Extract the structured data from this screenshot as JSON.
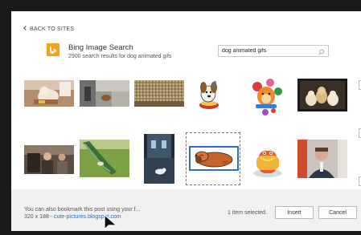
{
  "dialog": {
    "close_glyph": "×",
    "back_label": "BACK TO SITES"
  },
  "service": {
    "name": "Bing Image Search",
    "summary": "2900 search results for dog animated gifs",
    "logo_icon": "bing-logo",
    "logo_color": "#f7a21b"
  },
  "search": {
    "value": "dog animated gifs",
    "icon": "search-icon"
  },
  "results": {
    "row1": [
      {
        "name": "result-dog-with-sign",
        "selected": false
      },
      {
        "name": "result-room-dog",
        "selected": false
      },
      {
        "name": "result-dog-fur",
        "selected": false
      },
      {
        "name": "result-cartoon-dog-bowl",
        "selected": false
      },
      {
        "name": "result-cartoon-dog-flowers",
        "selected": false
      },
      {
        "name": "result-puppies-group",
        "selected": false
      }
    ],
    "row2": [
      {
        "name": "result-people-room",
        "selected": false
      },
      {
        "name": "result-dog-slide",
        "selected": false
      },
      {
        "name": "result-dog-night",
        "selected": false
      },
      {
        "name": "result-cartoon-sleeping-dog",
        "selected": true
      },
      {
        "name": "result-cartoon-hotdog",
        "selected": false
      },
      {
        "name": "result-man-video",
        "selected": false
      }
    ]
  },
  "footer": {
    "note": "You can also bookmark this post using your f...",
    "dimensions": "320 x 188 - ",
    "source_link": "cute-pictures.blogspot.com",
    "selection_status": "1 item selected.",
    "insert_label": "Insert",
    "cancel_label": "Cancel"
  },
  "colors": {
    "selection_border": "#2f6fc8",
    "link": "#2a6ebb",
    "footer_bg": "#f1f1f1"
  }
}
